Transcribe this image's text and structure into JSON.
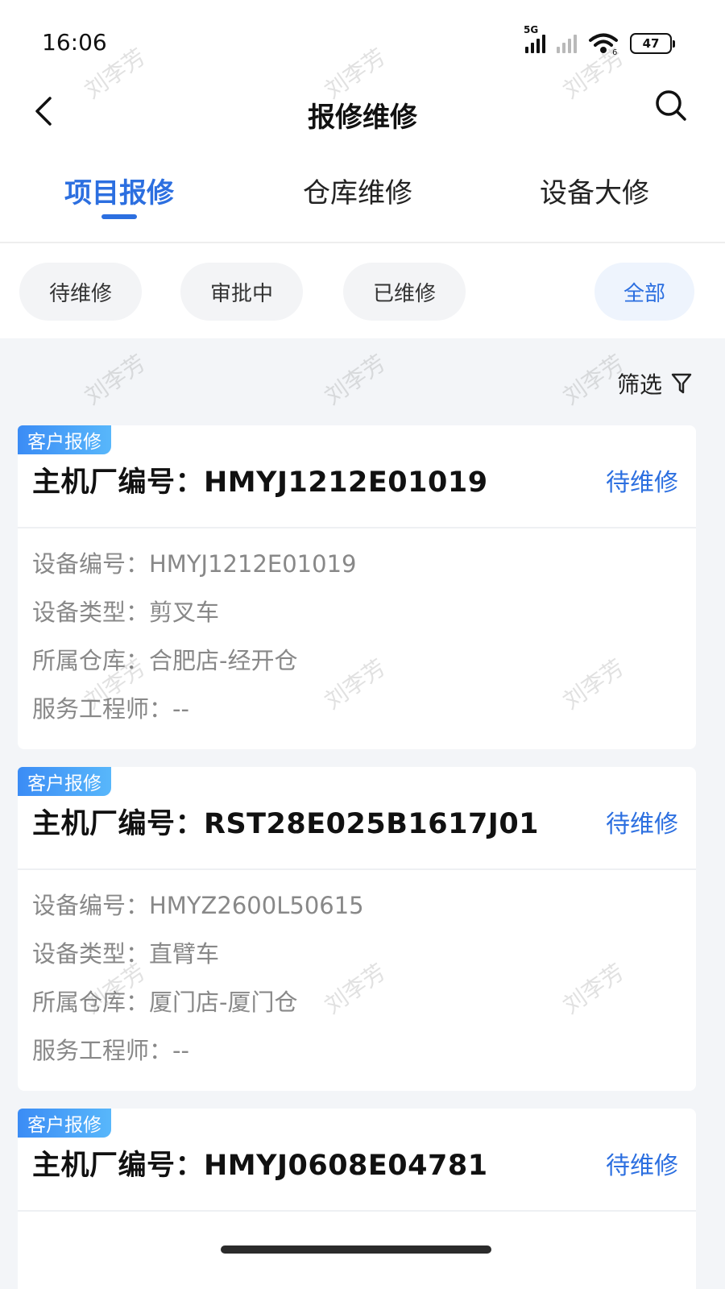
{
  "status_bar": {
    "time": "16:06",
    "network": "5G",
    "wifi_sub": "6",
    "battery": "47"
  },
  "nav": {
    "title": "报修维修"
  },
  "tabs": [
    {
      "label": "项目报修",
      "active": true
    },
    {
      "label": "仓库维修",
      "active": false
    },
    {
      "label": "设备大修",
      "active": false
    }
  ],
  "filters": [
    {
      "label": "待维修",
      "active": false
    },
    {
      "label": "审批中",
      "active": false
    },
    {
      "label": "已维修",
      "active": false
    },
    {
      "label": "全部",
      "active": true
    }
  ],
  "filter_button": {
    "label": "筛选"
  },
  "cards": [
    {
      "badge": "客户报修",
      "title": "主机厂编号：HMYJ1212E01019",
      "status": "待维修",
      "rows": [
        "设备编号：HMYJ1212E01019",
        "设备类型：剪叉车",
        "所属仓库：合肥店-经开仓",
        "服务工程师：--"
      ]
    },
    {
      "badge": "客户报修",
      "title": "主机厂编号：RST28E025B1617J01",
      "status": "待维修",
      "rows": [
        "设备编号：HMYZ2600L50615",
        "设备类型：直臂车",
        "所属仓库：厦门店-厦门仓",
        "服务工程师：--"
      ]
    },
    {
      "badge": "客户报修",
      "title": "主机厂编号：HMYJ0608E04781",
      "status": "待维修",
      "rows": []
    }
  ],
  "watermark": "刘李芳",
  "colors": {
    "accent": "#2c6fe0",
    "background": "#f3f5f8",
    "badge": "#3b8cf5"
  }
}
